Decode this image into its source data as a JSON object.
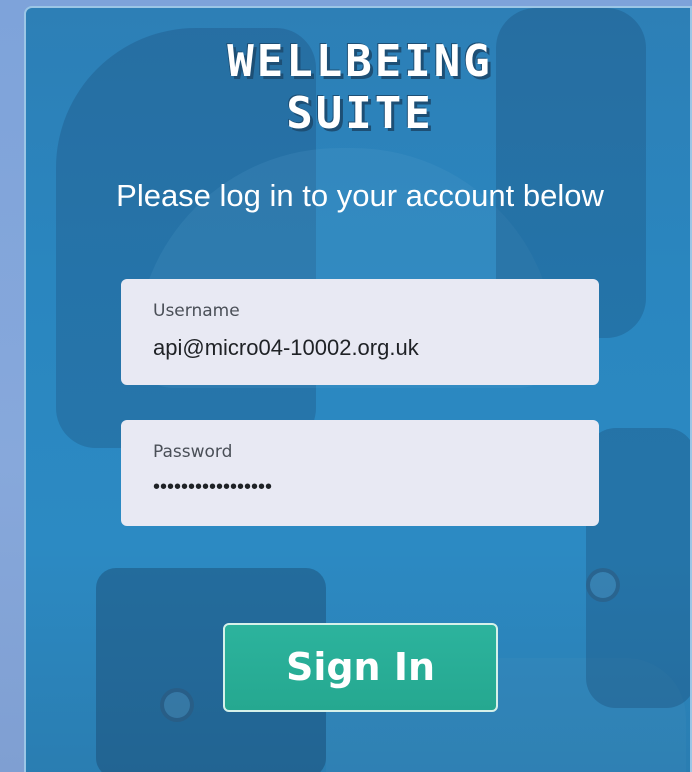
{
  "app": {
    "logo_line1": "WELLBEING",
    "logo_line2": "SUITE"
  },
  "login": {
    "subtitle": "Please log in to your account below",
    "username": {
      "label": "Username",
      "value": "api@micro04-10002.org.uk"
    },
    "password": {
      "label": "Password",
      "masked_value": "•••••••••••••••••"
    },
    "sign_in_label": "Sign In"
  },
  "colors": {
    "panel_blue": "#2a86bf",
    "field_background": "#e8e9f3",
    "sign_in_button": "#2cb39d",
    "page_background": "#7ea3da"
  }
}
